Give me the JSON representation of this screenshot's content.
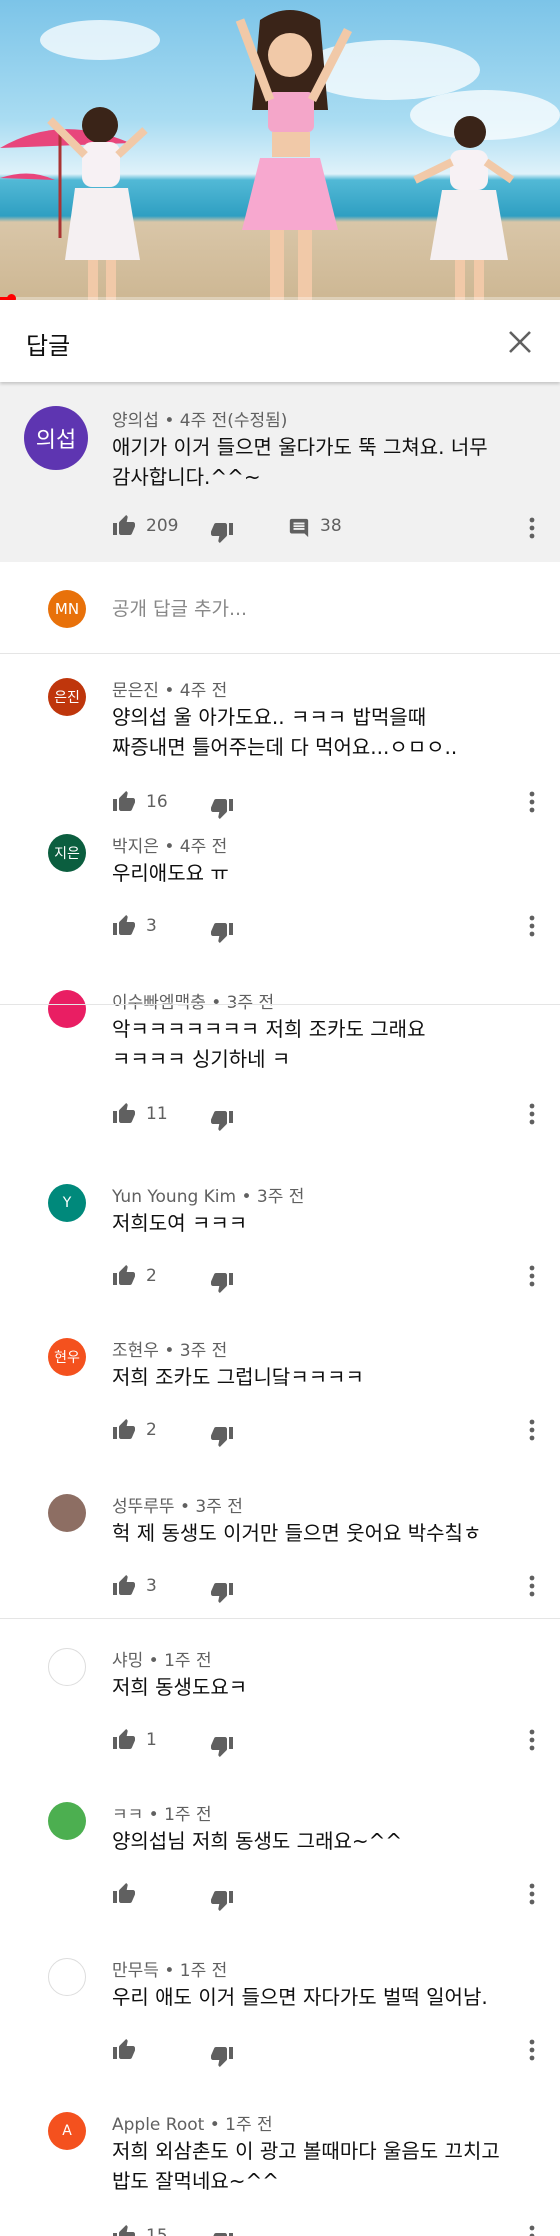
{
  "header": {
    "title": "답글"
  },
  "video": {
    "progress_fraction": 0.02
  },
  "parent": {
    "avatar_text": "의섭",
    "avatar_color": "#5e35b1",
    "meta": "양의섭 • 4주 전(수정됨)",
    "text_line1": "애기가 이거 들으면 울다가도 뚝 그쳐요. 너무",
    "text_line2": "감사합니다.^^~",
    "likes": "209",
    "replies": "38"
  },
  "add_reply": {
    "avatar_text": "MN",
    "avatar_color": "#e8710a",
    "placeholder": "공개 답글 추가..."
  },
  "replies": [
    {
      "avatar_text": "은진",
      "avatar_color": "#bf360c",
      "meta": "문은진 • 4주 전",
      "line1": "양의섭 울 아가도요.. ㅋㅋㅋ 밥먹을때",
      "line2": "짜증내면 틀어주는데 다 먹어요...ㅇㅁㅇ..",
      "likes": "16"
    },
    {
      "avatar_text": "지은",
      "avatar_color": "#0b5e3f",
      "meta": "박지은 • 4주 전",
      "line1": "우리애도요 ㅠ",
      "line2": "",
      "likes": "3"
    },
    {
      "avatar_text": "",
      "avatar_color": "#e91e63",
      "meta": "이수빠엠맥충 • 3주 전",
      "line1": "악ㅋㅋㅋㅋㅋㅋㅋ 저희 조카도 그래요",
      "line2": "ㅋㅋㅋㅋ 싱기하네 ㅋ",
      "likes": "11"
    },
    {
      "avatar_text": "Y",
      "avatar_color": "#00897b",
      "meta": "Yun Young Kim • 3주 전",
      "line1": "저희도여 ㅋㅋㅋ",
      "line2": "",
      "likes": "2"
    },
    {
      "avatar_text": "현우",
      "avatar_color": "#f4511e",
      "meta": "조현우 • 3주 전",
      "line1": "저희 조카도 그럽니닼ㅋㅋㅋㅋ",
      "line2": "",
      "likes": "2"
    },
    {
      "avatar_text": "",
      "avatar_color": "#8d6e63",
      "meta": "성뚜루뚜 • 3주 전",
      "line1": "헉 제 동생도 이거만 들으면 웃어요 박수칰ㅎ",
      "line2": "",
      "likes": "3"
    },
    {
      "avatar_text": "",
      "avatar_color": "#ffffff",
      "meta": "샤밍 • 1주 전",
      "line1": "저희 동생도요ㅋ",
      "line2": "",
      "likes": "1"
    },
    {
      "avatar_text": "",
      "avatar_color": "#4caf50",
      "meta": "ㅋㅋ • 1주 전",
      "line1": "양의섭님 저희 동생도 그래요~^^",
      "line2": "",
      "likes": ""
    },
    {
      "avatar_text": "",
      "avatar_color": "#ffffff",
      "meta": "만무득 • 1주 전",
      "line1": "우리 애도 이거 들으면 자다가도 벌떡 일어남.",
      "line2": "",
      "likes": ""
    },
    {
      "avatar_text": "A",
      "avatar_color": "#f4511e",
      "meta": "Apple Root • 1주 전",
      "line1": "저희 외삼촌도 이 광고 볼때마다 울음도 끄치고",
      "line2": "밥도 잘먹네요~^^",
      "likes": "15"
    }
  ]
}
